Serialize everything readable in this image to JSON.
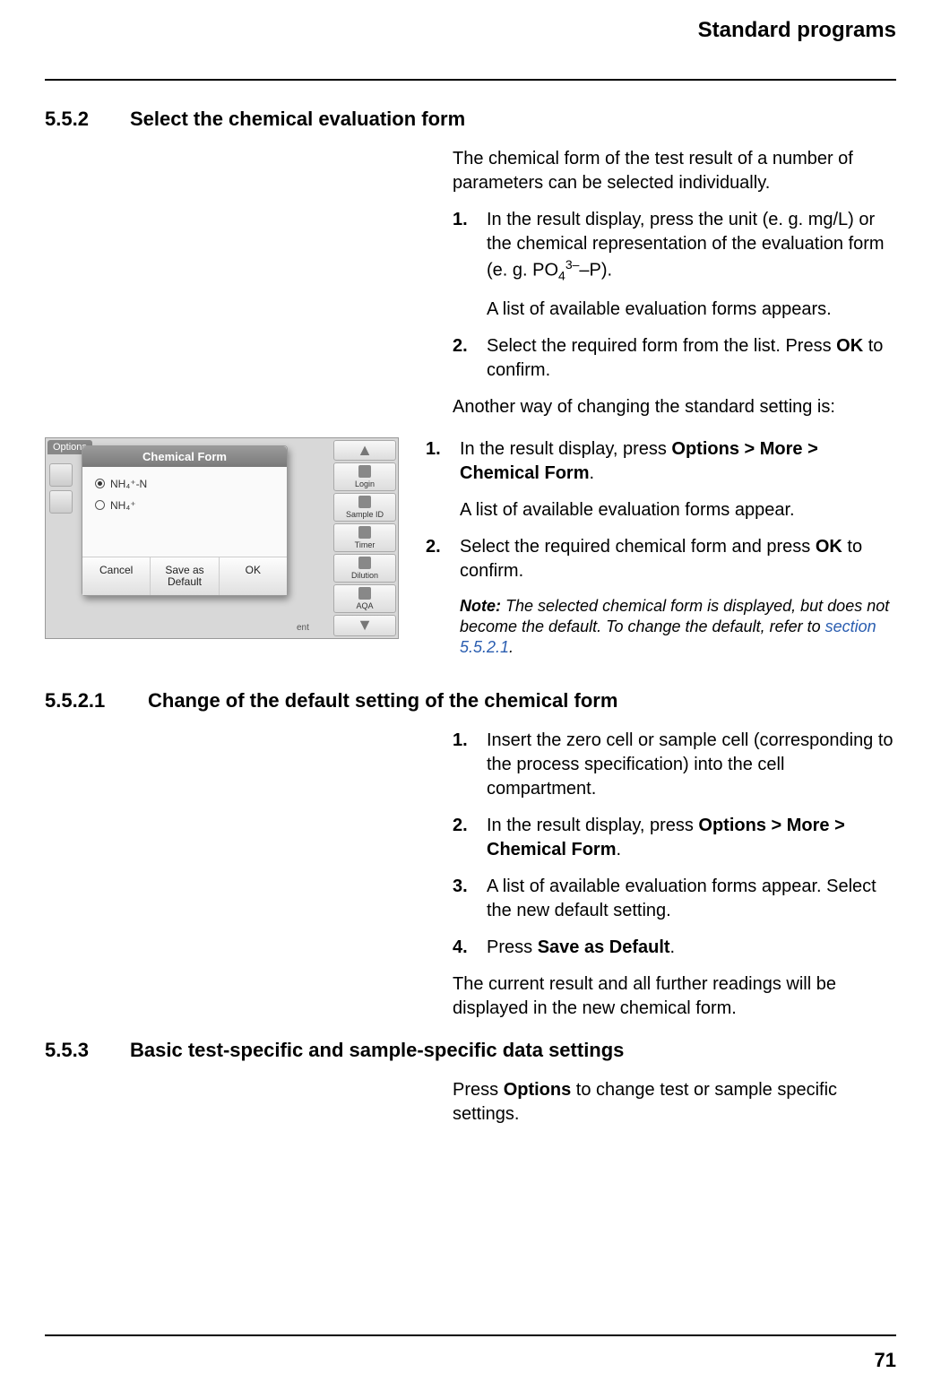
{
  "header": {
    "title": "Standard programs"
  },
  "s552": {
    "num": "5.5.2",
    "title": "Select the chemical evaluation form",
    "intro": "The chemical form of the test result of a number of parameters can be selected individually.",
    "steps_a": {
      "s1_pre": "In the result display, press the unit (e. g. mg/L) or the chemical representation of the evaluation form (e. g. PO",
      "s1_sub": "4",
      "s1_sup": "3–",
      "s1_post": "–P).",
      "s1_after": "A list of available evaluation forms appears.",
      "s2_pre": "Select the required form from the list. Press ",
      "s2_bold": "OK",
      "s2_post": " to confirm."
    },
    "alt_intro": "Another way of changing the standard setting is:",
    "steps_b": {
      "s1_pre": "In the result display, press ",
      "s1_bold": "Options > More > Chemical Form",
      "s1_post": ".",
      "s1_after": "A list of available evaluation forms appear.",
      "s2_pre": "Select the required chemical form and press ",
      "s2_bold": "OK",
      "s2_post": " to confirm."
    },
    "note_label": "Note:",
    "note_body": " The selected chemical form is displayed, but does not become the default. To change the default, refer to ",
    "note_link": "section 5.5.2.1",
    "note_end": "."
  },
  "s5521": {
    "num": "5.5.2.1",
    "title": "Change of the default setting of the chemical form",
    "steps": {
      "s1": "Insert the zero cell or sample cell (corresponding to the process specification) into the cell compartment.",
      "s2_pre": "In the result display, press ",
      "s2_bold": "Options > More > Chemical Form",
      "s2_post": ".",
      "s3": "A list of available evaluation forms appear. Select the new default setting.",
      "s4_pre": "Press ",
      "s4_bold": "Save as Default",
      "s4_post": "."
    },
    "outro": "The current result and all further readings will be displayed in the new chemical form."
  },
  "s553": {
    "num": "5.5.3",
    "title": "Basic test-specific and sample-specific data settings",
    "body_pre": "Press ",
    "body_bold": "Options",
    "body_post": " to change test or sample specific settings."
  },
  "screenshot": {
    "options_tab": "Options",
    "dialog_title": "Chemical Form",
    "radio1": "NH₄⁺-N",
    "radio2": "NH₄⁺",
    "btn_cancel": "Cancel",
    "btn_save": "Save as Default",
    "btn_ok": "OK",
    "side": {
      "login": "Login",
      "sample": "Sample ID",
      "timer": "Timer",
      "dilution": "Dilution",
      "aqa": "AQA"
    },
    "bottom_frag": "ent"
  },
  "page_number": "71"
}
